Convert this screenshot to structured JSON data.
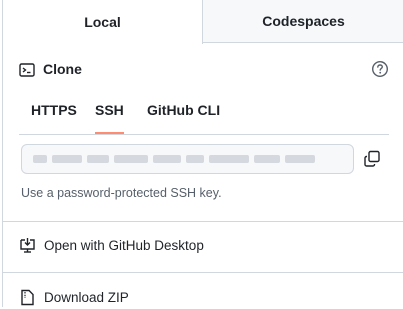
{
  "tabs": {
    "local": "Local",
    "codespaces": "Codespaces"
  },
  "clone": {
    "title": "Clone",
    "icon": "terminal-icon",
    "help_icon": "question-circle-icon",
    "protocols": [
      "HTTPS",
      "SSH",
      "GitHub CLI"
    ],
    "active_protocol": "SSH",
    "url_value": "",
    "hint": "Use a password-protected SSH key."
  },
  "actions": {
    "open_desktop": "Open with GitHub Desktop",
    "download_zip": "Download ZIP"
  },
  "colors": {
    "active_underline": "#fd8c73",
    "border": "#d0d7de",
    "inactive_tab_bg": "#f6f8fa",
    "muted_text": "#57606a"
  }
}
